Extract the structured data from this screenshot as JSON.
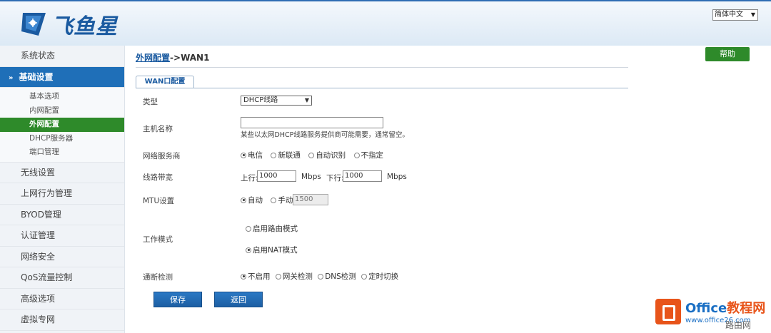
{
  "header": {
    "logo_text": "飞鱼星",
    "language": "简体中文"
  },
  "sidebar": {
    "items": [
      {
        "label": "系统状态"
      },
      {
        "label": "基础设置"
      },
      {
        "label": "无线设置"
      },
      {
        "label": "上网行为管理"
      },
      {
        "label": "BYOD管理"
      },
      {
        "label": "认证管理"
      },
      {
        "label": "网络安全"
      },
      {
        "label": "QoS流量控制"
      },
      {
        "label": "高级选项"
      },
      {
        "label": "虚拟专网"
      }
    ],
    "sub_items": [
      {
        "label": "基本选项"
      },
      {
        "label": "内网配置"
      },
      {
        "label": "外网配置"
      },
      {
        "label": "DHCP服务器"
      },
      {
        "label": "端口管理"
      }
    ]
  },
  "main": {
    "breadcrumb_link": "外网配置",
    "breadcrumb_sep": "->",
    "breadcrumb_current": "WAN1",
    "help": "帮助",
    "tab": "WAN口配置",
    "type_label": "类型",
    "type_value": "DHCP线路",
    "hostname_label": "主机名称",
    "hostname_value": "",
    "hostname_hint": "某些以太网DHCP线路服务提供商可能需要，通常留空。",
    "isp_label": "网络服务商",
    "isp_options": [
      "电信",
      "新联通",
      "自动识别",
      "不指定"
    ],
    "bandwidth_label": "线路带宽",
    "up_label": "上行:",
    "up_value": "1000",
    "up_unit": "Mbps",
    "down_label": "下行:",
    "down_value": "1000",
    "down_unit": "Mbps",
    "mtu_label": "MTU设置",
    "mtu_auto": "自动",
    "mtu_manual": "手动",
    "mtu_value": "1500",
    "mode_label": "工作模式",
    "mode_router": "启用路由模式",
    "mode_nat": "启用NAT模式",
    "detect_label": "通断检测",
    "detect_options": [
      "不启用",
      "网关检测",
      "DNS检测",
      "定时切换"
    ],
    "save": "保存",
    "back": "返回"
  },
  "watermark": {
    "title_a": "Office",
    "title_b": "教程网",
    "url": "www.office26.com",
    "corner": "路由网"
  },
  "colors": {
    "nav_active": "#1f6fb8",
    "sub_active": "#2e8a2a",
    "help": "#2e8a2a",
    "button": "#1d5fa3"
  }
}
